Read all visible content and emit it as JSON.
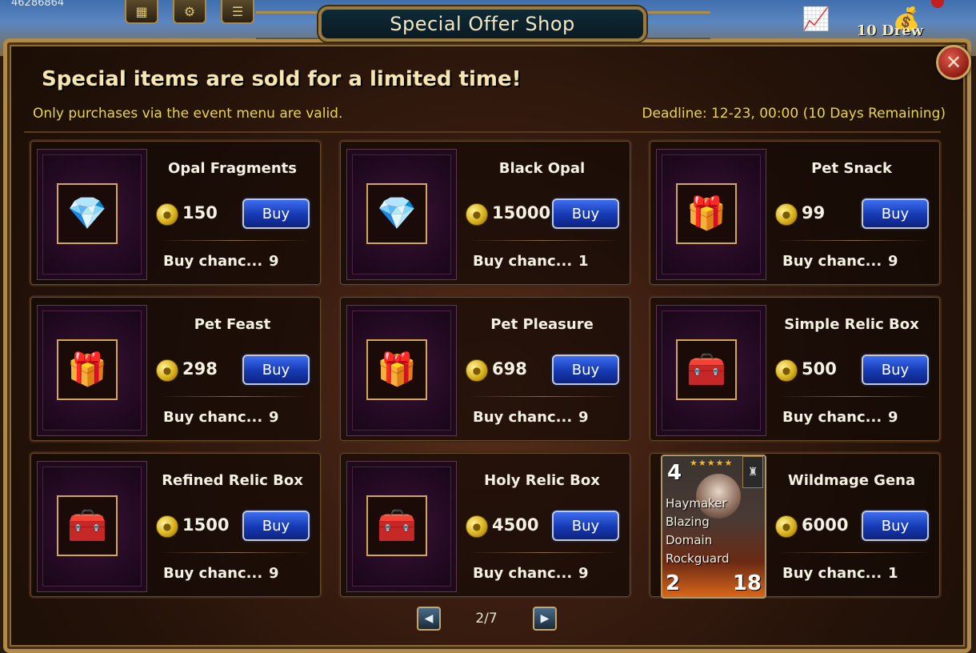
{
  "top_bar": {
    "counter": "46286864",
    "draw_label": "10 Drew"
  },
  "dialog": {
    "title": "Special Offer Shop",
    "close_glyph": "✕",
    "headline": "Special items are sold for a limited time!",
    "note": "Only purchases via the event menu are valid.",
    "deadline": "Deadline: 12-23, 00:00 (10 Days Remaining)"
  },
  "buy_label": "Buy",
  "chance_label": "Buy chanc...",
  "items": [
    {
      "name": "Opal Fragments",
      "price": "150",
      "chance": "9",
      "icon": "opal-fragments-icon",
      "emoji": "💎"
    },
    {
      "name": "Black Opal",
      "price": "15000",
      "chance": "1",
      "icon": "black-opal-icon",
      "emoji": "💎"
    },
    {
      "name": "Pet Snack",
      "price": "99",
      "chance": "9",
      "icon": "gift-box-icon",
      "emoji": "🎁"
    },
    {
      "name": "Pet Feast",
      "price": "298",
      "chance": "9",
      "icon": "red-gift-box-icon",
      "emoji": "🎁"
    },
    {
      "name": "Pet Pleasure",
      "price": "698",
      "chance": "9",
      "icon": "red-gift-box-icon",
      "emoji": "🎁"
    },
    {
      "name": "Simple Relic Box",
      "price": "500",
      "chance": "9",
      "icon": "blue-chest-icon",
      "emoji": "🧰"
    },
    {
      "name": "Refined Relic Box",
      "price": "1500",
      "chance": "9",
      "icon": "gold-chest-icon",
      "emoji": "🧰"
    },
    {
      "name": "Holy Relic Box",
      "price": "4500",
      "chance": "9",
      "icon": "red-chest-icon",
      "emoji": "🧰"
    },
    {
      "name": "Wildmage Gena",
      "price": "6000",
      "chance": "1",
      "icon": "hero-card-icon",
      "emoji": ""
    }
  ],
  "hero_card": {
    "level": "4",
    "stars": "★★★★★",
    "skills": [
      "Haymaker",
      "Blazing",
      "Domain",
      "Rockguard"
    ],
    "attack": "2",
    "health": "18"
  },
  "pager": {
    "text": "2/7",
    "prev_glyph": "◀",
    "next_glyph": "▶"
  },
  "colors": {
    "accent_gold": "#b08a48",
    "note_yellow": "#e8d64a",
    "buy_blue": "#1638b2"
  }
}
